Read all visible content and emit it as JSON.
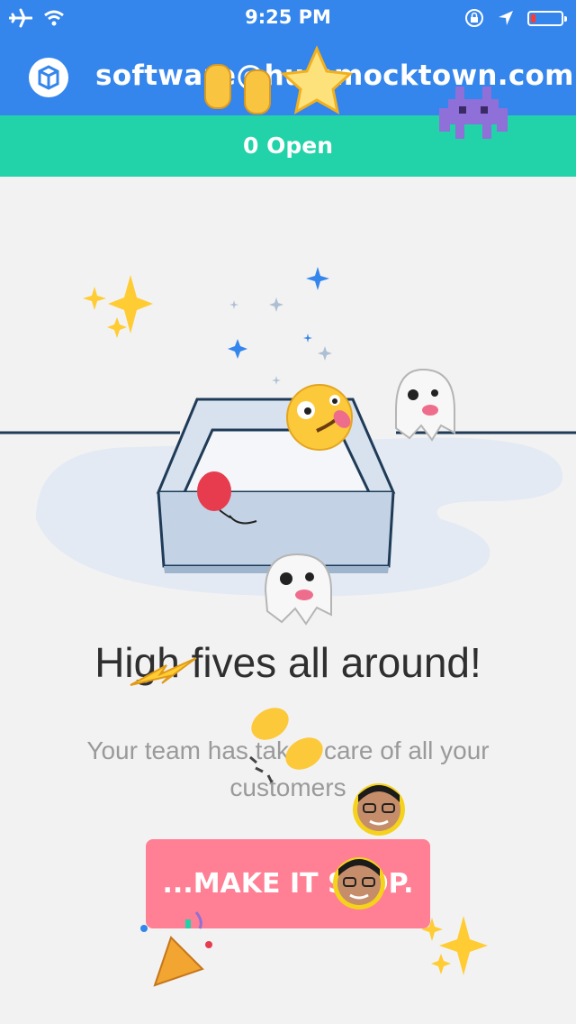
{
  "status_bar": {
    "time": "9:25 PM",
    "icons": [
      "airplane-icon",
      "wifi-icon",
      "orientation-lock-icon",
      "location-arrow-icon",
      "battery-icon"
    ],
    "battery_level": 0.15
  },
  "header": {
    "logo": "help-desk-logo-icon",
    "account_email": "software@hummocktown.com"
  },
  "tabs": {
    "open_label": "0 Open"
  },
  "empty_state": {
    "illustration": "empty-inbox-tray",
    "title": "High fives all around!",
    "message": "Your team has taken care of all your customers",
    "cta_label": "...MAKE IT STOP."
  },
  "celebration": {
    "emojis": [
      "raised-hands",
      "star",
      "space-invader",
      "sparkles",
      "ghost",
      "zany-face",
      "balloon",
      "lightning",
      "clapping-hands",
      "face-photo",
      "party-popper"
    ]
  },
  "colors": {
    "header_blue": "#3485ec",
    "open_bar_green": "#22d2a8",
    "cta_pink": "#ff7f94",
    "background": "#f2f2f2"
  }
}
